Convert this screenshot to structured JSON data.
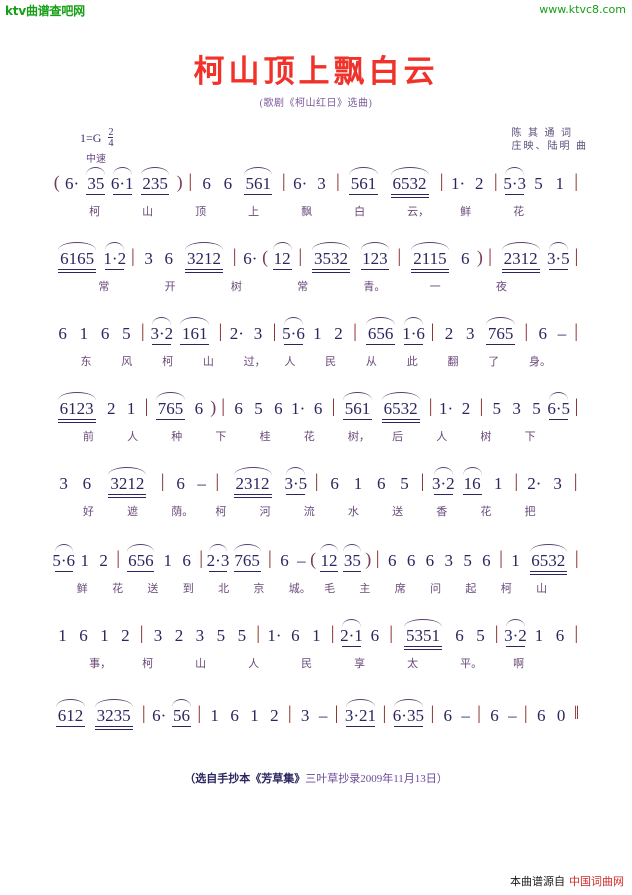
{
  "topbar": {
    "logo": "ktv曲谱查吧网",
    "url": "www.ktvc8.com"
  },
  "title": "柯山顶上飘白云",
  "subtitle": "(歌剧《柯山红日》选曲)",
  "key_signature": "1=G",
  "time_signature": {
    "numerator": "2",
    "denominator": "4"
  },
  "tempo": "中速",
  "credits": {
    "lyricist": "陈 其 通 词",
    "composer": "庄映、陆明 曲"
  },
  "score": {
    "lines": [
      {
        "notes": "( 6· 35 6·1 235 ) | 6 6 561 | 6· 3 | 561 6532 | 1· 2 | 5·3 5 1 |",
        "lyrics": "柯 山 顶 上 飘 白 云， 鲜 花"
      },
      {
        "notes": "6165 1·2 | 3 6 3212 | 6· ( 12 | 3532 123 | 2115 6 ) | 2312 3·5 |",
        "lyrics": "常 开 树 常 青。 一 夜"
      },
      {
        "notes": "6 1 6 5 | 3·2 161 | 2· 3 | 5·6 1 2 | 656 1·6 | 2 3 765 | 6 – |",
        "lyrics": "东 风 柯 山 过， 人 民 从 此 翻 了 身。"
      },
      {
        "notes": "6123 2 1 | 765 6 ) | 6 5 6 1· 6 | 561 6532 | 1· 2 | 5 3 5 6·5 |",
        "lyrics": "前 人 种 下 桂 花 树， 后 人 树 下"
      },
      {
        "notes": "3 6 3212 | 6 – | 2312 3·5 | 6 1 6 5 | 3·2 16 1 | 2· 3 |",
        "lyrics": "好 遮 荫。 柯 河 流 水 送 香 花 把"
      },
      {
        "notes": "5·6 1 2 | 656 1 6 | 2·3 765 | 6 – ( 12 35 ) | 6 6 6 3 5 6 | 1 6532 |",
        "lyrics": "鲜 花 送 到 北 京 城。 毛 主 席 问 起 柯 山"
      },
      {
        "notes": "1 6 1 2 | 3 2 3 5 5 | 1· 6 1 | 2·1 6 | 5351 6 5 | 3·2 1 6 |",
        "lyrics": "事， 柯 山 人 民 享 太 平。 啊"
      },
      {
        "notes": "612 3235 | 6· 56 | 1 6 1 2 | 3 – | 3·21 | 6·35 | 6 – | 6 – | 6 0 ‖",
        "lyrics": ""
      }
    ]
  },
  "source_note": {
    "prefix": "（选自手抄本",
    "collection": "《芳草集》",
    "suffix": "三叶草抄录2009年11月13日）"
  },
  "footer": {
    "label": "本曲谱源自",
    "brand": "中国词曲网"
  },
  "colors": {
    "title": "#f0322a",
    "logo": "#16a016",
    "notes": "#2b2560",
    "lyrics": "#6a4a7a",
    "barline": "#8a2a2a",
    "brand": "#d02a2a"
  }
}
